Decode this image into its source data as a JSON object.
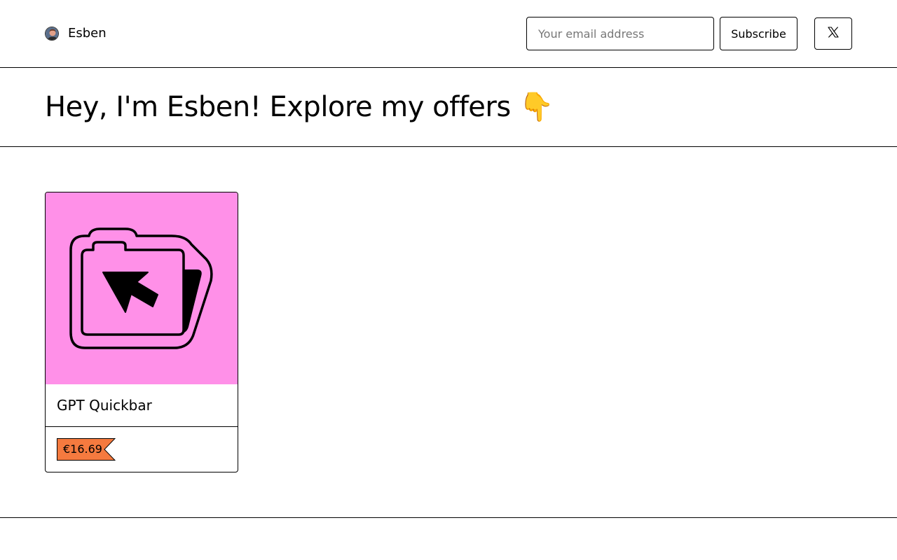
{
  "header": {
    "brand_name": "Esben",
    "email_placeholder": "Your email address",
    "subscribe_label": "Subscribe",
    "social_icon": "x-logo-icon"
  },
  "hero": {
    "title": "Hey, I'm Esben! Explore my offers 👇"
  },
  "products": [
    {
      "name": "GPT Quickbar",
      "price": "€16.69",
      "thumbnail_icon": "folder-cursor-icon",
      "thumbnail_color": "#ff90e8",
      "price_tag_color": "#f57a3f"
    }
  ]
}
